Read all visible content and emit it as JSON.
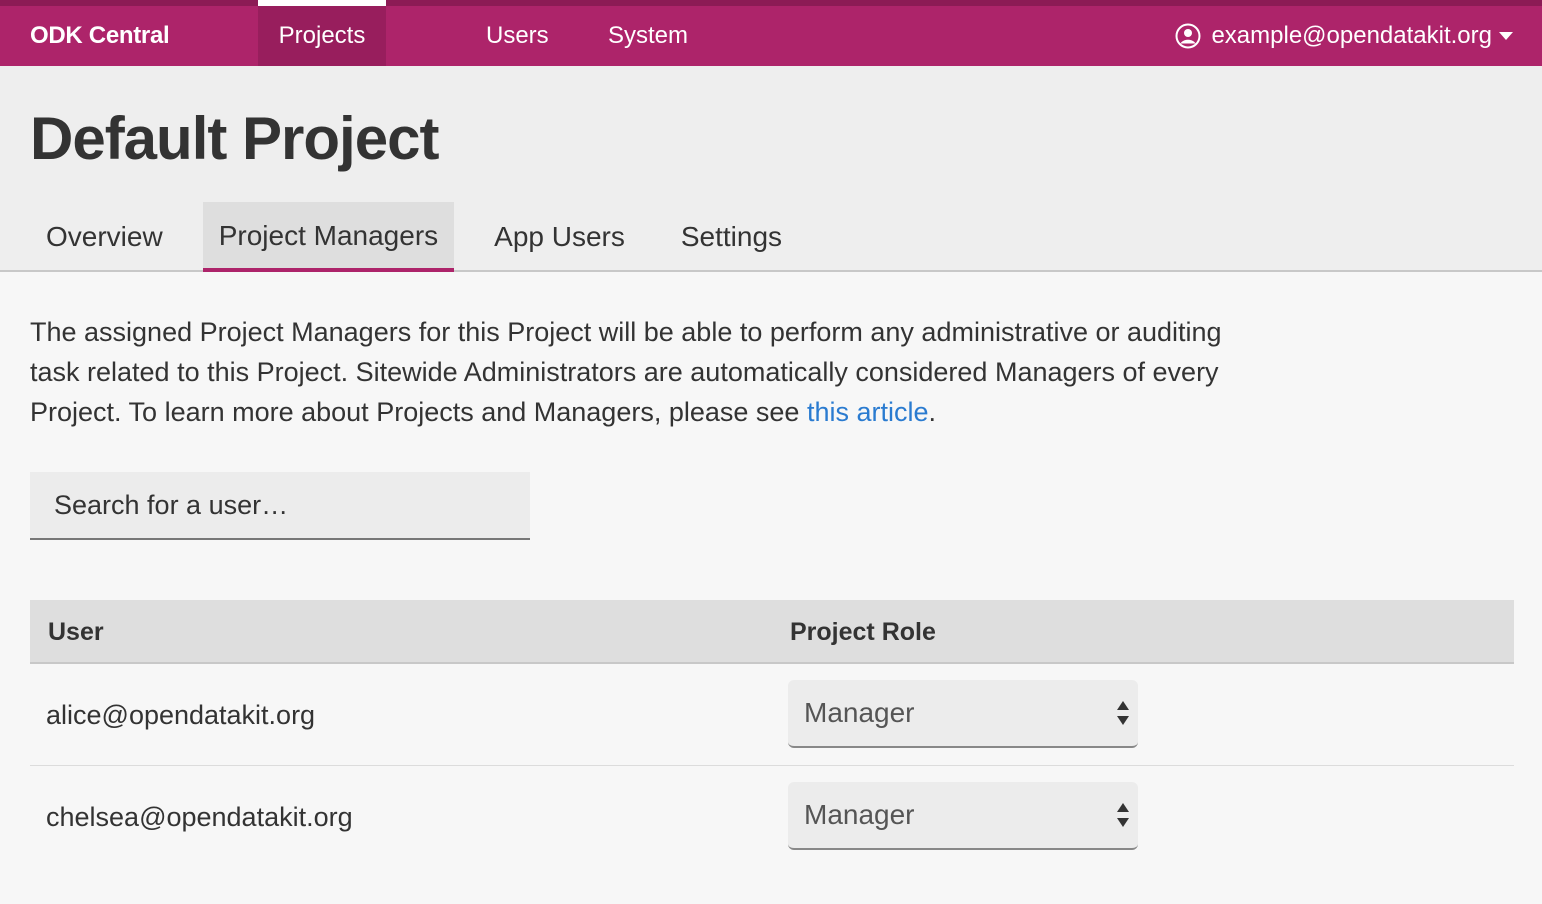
{
  "navbar": {
    "brand": "ODK Central",
    "items": [
      {
        "label": "Projects",
        "active": true
      },
      {
        "label": "Users",
        "active": false
      },
      {
        "label": "System",
        "active": false
      }
    ],
    "account": {
      "email": "example@opendatakit.org",
      "icon": "user-circle-icon"
    }
  },
  "page": {
    "title": "Default Project",
    "tabs": [
      {
        "label": "Overview",
        "active": false
      },
      {
        "label": "Project Managers",
        "active": true
      },
      {
        "label": "App Users",
        "active": false
      },
      {
        "label": "Settings",
        "active": false
      }
    ]
  },
  "description": {
    "text": "The assigned Project Managers for this Project will be able to perform any administrative or auditing task related to this Project. Sitewide Administrators are automatically considered Managers of every Project. To learn more about Projects and Managers, please see ",
    "link_text": "this article",
    "trailing": "."
  },
  "search": {
    "placeholder": "Search for a user…"
  },
  "table": {
    "headers": {
      "user": "User",
      "role": "Project Role"
    },
    "rows": [
      {
        "user": "alice@opendatakit.org",
        "role": "Manager"
      },
      {
        "user": "chelsea@opendatakit.org",
        "role": "Manager"
      }
    ]
  },
  "colors": {
    "brand": "#ad246a",
    "link": "#2a7bd0"
  }
}
